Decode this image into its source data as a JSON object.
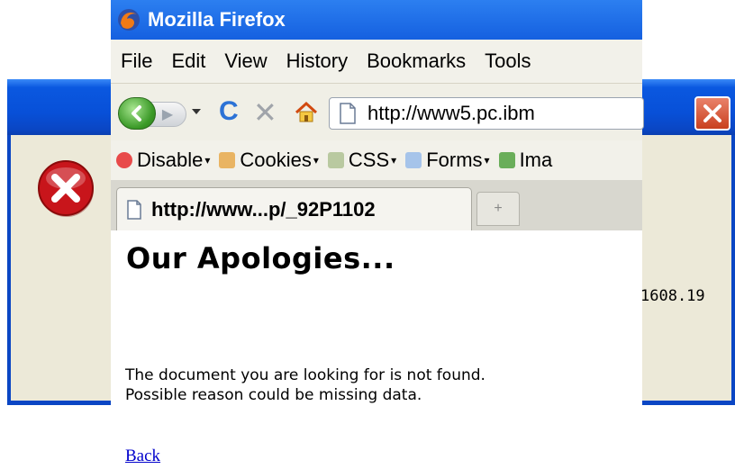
{
  "dialog": {
    "partial_text": "1608.19"
  },
  "firefox": {
    "title": "Mozilla Firefox",
    "menus": [
      {
        "label": "File"
      },
      {
        "label": "Edit"
      },
      {
        "label": "View"
      },
      {
        "label": "History"
      },
      {
        "label": "Bookmarks"
      },
      {
        "label": "Tools"
      }
    ],
    "url": "http://www5.pc.ibm",
    "toolbar": [
      {
        "label": "Disable",
        "icon": "disable-icon"
      },
      {
        "label": "Cookies",
        "icon": "cookies-icon"
      },
      {
        "label": "CSS",
        "icon": "css-icon"
      },
      {
        "label": "Forms",
        "icon": "forms-icon"
      },
      {
        "label": "Ima",
        "icon": "images-icon"
      }
    ],
    "tab_title": "http://www...p/_92P1102",
    "new_tab_symbol": "+"
  },
  "page": {
    "heading": "Our Apologies...",
    "message_line1": "The document you are looking for is not found.",
    "message_line2": "Possible reason could be missing data.",
    "back_link": "Back"
  },
  "colors": {
    "xp_titlebar": "#0850d8",
    "dialog_bg": "#ece9d8",
    "link": "#0000cc"
  }
}
